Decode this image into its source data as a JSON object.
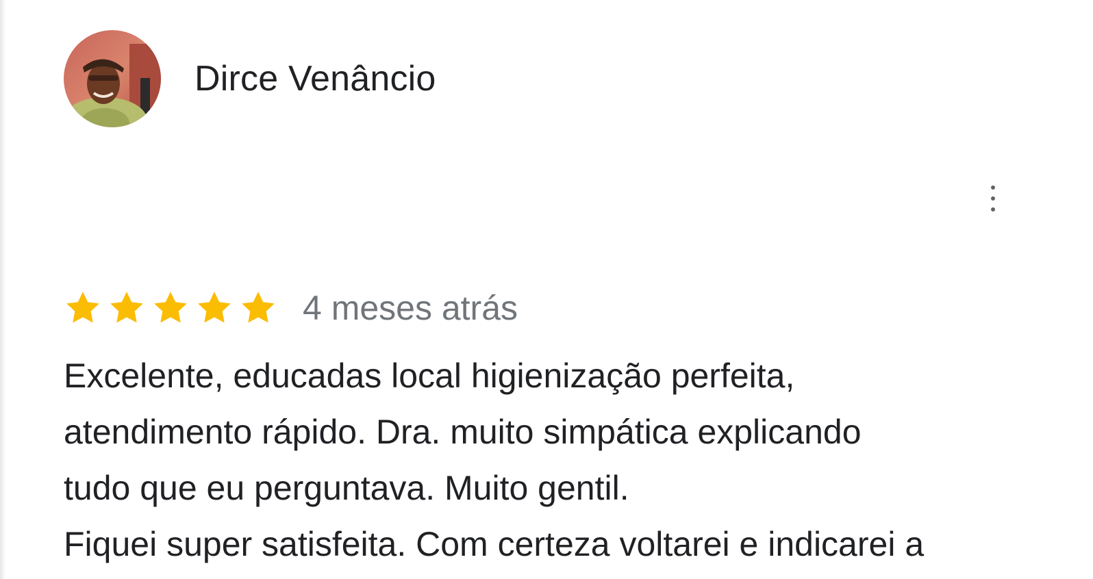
{
  "reviewer": {
    "name": "Dirce Venâncio",
    "avatar_icon": "reviewer-photo"
  },
  "more_options_icon": "vertical-dots-icon",
  "rating": {
    "stars": 5,
    "max_stars": 5,
    "star_color": "#fbbc04",
    "date": "4 meses atrás"
  },
  "review": {
    "text": "Excelente, educadas local higienização perfeita,\natendimento rápido. Dra. muito simpática explicando\ntudo que eu perguntava. Muito gentil.\nFiquei super satisfeita. Com certeza voltarei e indicarei a"
  },
  "colors": {
    "name_text": "#202124",
    "secondary_text": "#70757a",
    "icon_gray": "#5f6368"
  }
}
